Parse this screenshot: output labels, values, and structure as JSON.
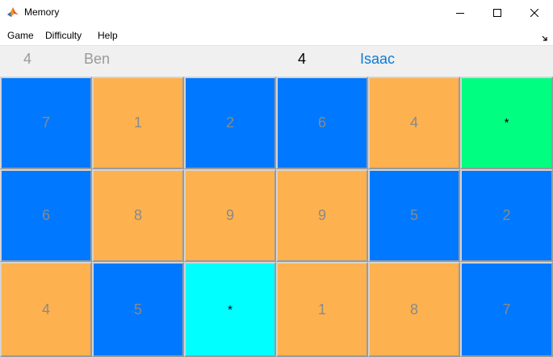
{
  "window": {
    "title": "Memory",
    "minimize_label": "—",
    "maximize_label": "☐",
    "close_label": "✕"
  },
  "menu": {
    "game": "Game",
    "difficulty": "Difficulty",
    "help": "Help"
  },
  "scoreboard": {
    "player1": {
      "score": "4",
      "name": "Ben",
      "active": false
    },
    "player2": {
      "score": "4",
      "name": "Isaac",
      "active": true
    }
  },
  "colors": {
    "blue": "#0078ff",
    "orange": "#fdb14f",
    "green": "#00ff80",
    "cyan": "#00ffff",
    "faded_text": "#8a8a8a",
    "revealed_text": "#000000",
    "active_player": "#0a7bd9"
  },
  "board": {
    "rows": [
      [
        {
          "label": "7",
          "color": "blue",
          "state": "matched"
        },
        {
          "label": "1",
          "color": "orange",
          "state": "matched"
        },
        {
          "label": "2",
          "color": "blue",
          "state": "matched"
        },
        {
          "label": "6",
          "color": "blue",
          "state": "matched"
        },
        {
          "label": "4",
          "color": "orange",
          "state": "matched"
        },
        {
          "label": "*",
          "color": "green",
          "state": "hidden"
        }
      ],
      [
        {
          "label": "6",
          "color": "blue",
          "state": "matched"
        },
        {
          "label": "8",
          "color": "orange",
          "state": "matched"
        },
        {
          "label": "9",
          "color": "orange",
          "state": "matched"
        },
        {
          "label": "9",
          "color": "orange",
          "state": "matched"
        },
        {
          "label": "5",
          "color": "blue",
          "state": "matched"
        },
        {
          "label": "2",
          "color": "blue",
          "state": "matched"
        }
      ],
      [
        {
          "label": "4",
          "color": "orange",
          "state": "matched"
        },
        {
          "label": "5",
          "color": "blue",
          "state": "matched"
        },
        {
          "label": "*",
          "color": "cyan",
          "state": "hidden"
        },
        {
          "label": "1",
          "color": "orange",
          "state": "matched"
        },
        {
          "label": "8",
          "color": "orange",
          "state": "matched"
        },
        {
          "label": "7",
          "color": "blue",
          "state": "matched"
        }
      ]
    ]
  }
}
